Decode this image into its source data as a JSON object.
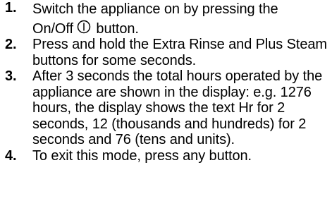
{
  "steps": [
    {
      "number": "1.",
      "text_before_icon": "Switch the appliance on by pressing the",
      "text_line2_before_icon": "On/Off",
      "icon": "power-icon",
      "text_after_icon": "button."
    },
    {
      "number": "2.",
      "text": "Press and hold the Extra Rinse and Plus Steam buttons for some seconds."
    },
    {
      "number": "3.",
      "text": "After 3 seconds the total hours operated by the appliance are shown in the display: e.g. 1276 hours, the display shows the text Hr for 2 seconds, 12 (thousands and hundreds) for 2 seconds and 76 (tens and units)."
    },
    {
      "number": "4.",
      "text": "To exit this mode, press any button."
    }
  ]
}
